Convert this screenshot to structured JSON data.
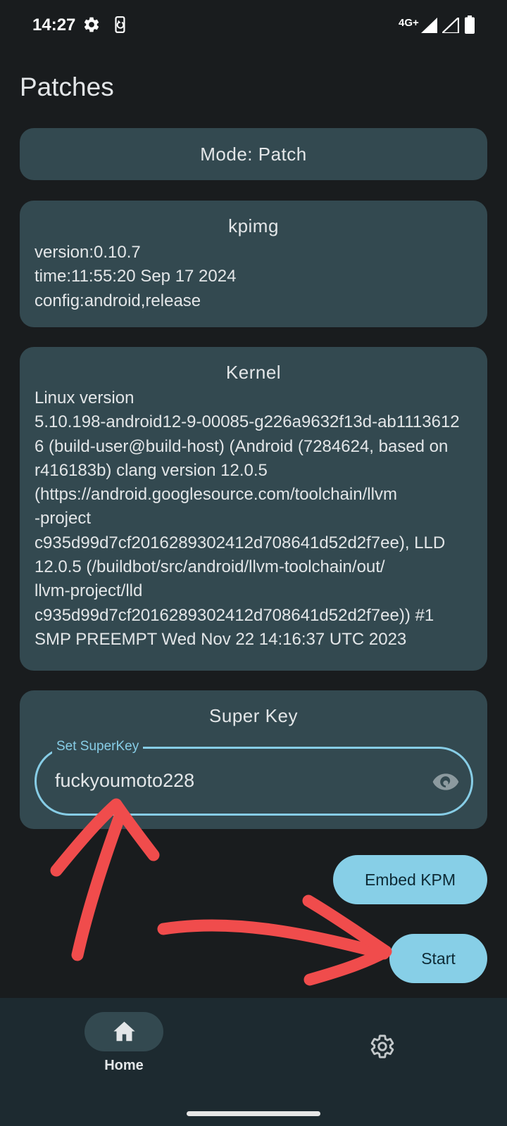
{
  "status_bar": {
    "time": "14:27",
    "network": "4G+",
    "icons": [
      "gear-icon",
      "screen-rotate-icon",
      "signal-icon",
      "battery-icon"
    ]
  },
  "page": {
    "title": "Patches"
  },
  "mode_card": {
    "label": "Mode: Patch"
  },
  "kpimg_card": {
    "title": "kpimg",
    "lines": [
      "version:0.10.7",
      "time:11:55:20 Sep 17 2024",
      "config:android,release"
    ]
  },
  "kernel_card": {
    "title": "Kernel",
    "text": "Linux version\n5.10.198-android12-9-00085-g226a9632f13d-ab1113612\n6 (build-user@build-host) (Android (7284624, based on\nr416183b) clang version 12.0.5\n(https://android.googlesource.com/toolchain/llvm\n-project\nc935d99d7cf2016289302412d708641d52d2f7ee), LLD\n12.0.5 (/buildbot/src/android/llvm-toolchain/out/\nllvm-project/lld\nc935d99d7cf2016289302412d708641d52d2f7ee)) #1\nSMP PREEMPT Wed Nov 22 14:16:37 UTC 2023"
  },
  "superkey_card": {
    "title": "Super Key",
    "field_label": "Set SuperKey",
    "field_value": "fuckyoumoto228"
  },
  "buttons": {
    "embed_kpm": "Embed KPM",
    "start": "Start"
  },
  "nav": {
    "home_label": "Home"
  },
  "colors": {
    "background": "#191c1e",
    "card": "#334950",
    "accent": "#87cfe7",
    "annotation": "#f04c4c"
  }
}
